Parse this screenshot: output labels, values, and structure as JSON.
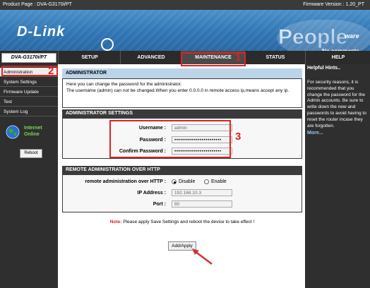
{
  "topbar": {
    "product_page": "Product Page : DVA-G3170i/PT",
    "firmware": "Firmware Version : 1.20_PT"
  },
  "banner": {
    "brand": "D-Link",
    "people_text": "People",
    "ware_text": "ware",
    "tagline": "No comments"
  },
  "nav": {
    "model": "DVA-G3170i/PT",
    "tabs": [
      {
        "label": "SETUP"
      },
      {
        "label": "ADVANCED"
      },
      {
        "label": "MAINTENANCE"
      },
      {
        "label": "STATUS"
      },
      {
        "label": "HELP"
      }
    ],
    "active_tab": "MAINTENANCE"
  },
  "sidebar": {
    "items": [
      {
        "label": "Administration"
      },
      {
        "label": "System Settings"
      },
      {
        "label": "Firmware Update"
      },
      {
        "label": "Test"
      },
      {
        "label": "System Log"
      }
    ],
    "internet_status": "Internet",
    "internet_status2": "Online",
    "reboot_label": "Reboot"
  },
  "admin": {
    "title": "ADMINISTRATOR",
    "desc1": "Here you can change the password for the administrator.",
    "desc2": "The username (admin) can not be changed.When you enter 0.0.0.0 in remote access ip,means accept any ip."
  },
  "settings": {
    "title": "ADMINISTRATOR SETTINGS",
    "username_label": "Username :",
    "username_value": "admin",
    "password_label": "Password :",
    "password_value": "••••••••••••••••••••••••",
    "confirm_label": "Confirm Password :",
    "confirm_value": "••••••••••••••••••••••••"
  },
  "remote": {
    "title": "REMOTE ADMINISTRATION OVER HTTP",
    "http_label": "remote administration over HTTP :",
    "disable_label": "Disable",
    "enable_label": "Enable",
    "selected": "Disable",
    "ip_label": "IP Address :",
    "ip_value": "192.168.10.3",
    "port_label": "Port :",
    "port_value": "80"
  },
  "note": {
    "prefix": "Note:",
    "text": "Please apply Save Settings and reboot the device to take effect !"
  },
  "apply_label": "Add/Apply",
  "help": {
    "title": "Helpful Hints..",
    "text": "For security reasons, it is recommended that you change the password for the Admin accounts. Be sure to write down the new and passwords to avoid having to reset the router incase they are forgotten.",
    "more": "More..."
  },
  "annotations": [
    "1",
    "2",
    "3"
  ],
  "colors": {
    "annotation_red": "#d22222",
    "header_dark": "#3a3a3a",
    "sidebar_bg": "#2f2f2f",
    "admin_title_bg": "#bcd4ea",
    "banner_blue": "#2f74b3"
  }
}
